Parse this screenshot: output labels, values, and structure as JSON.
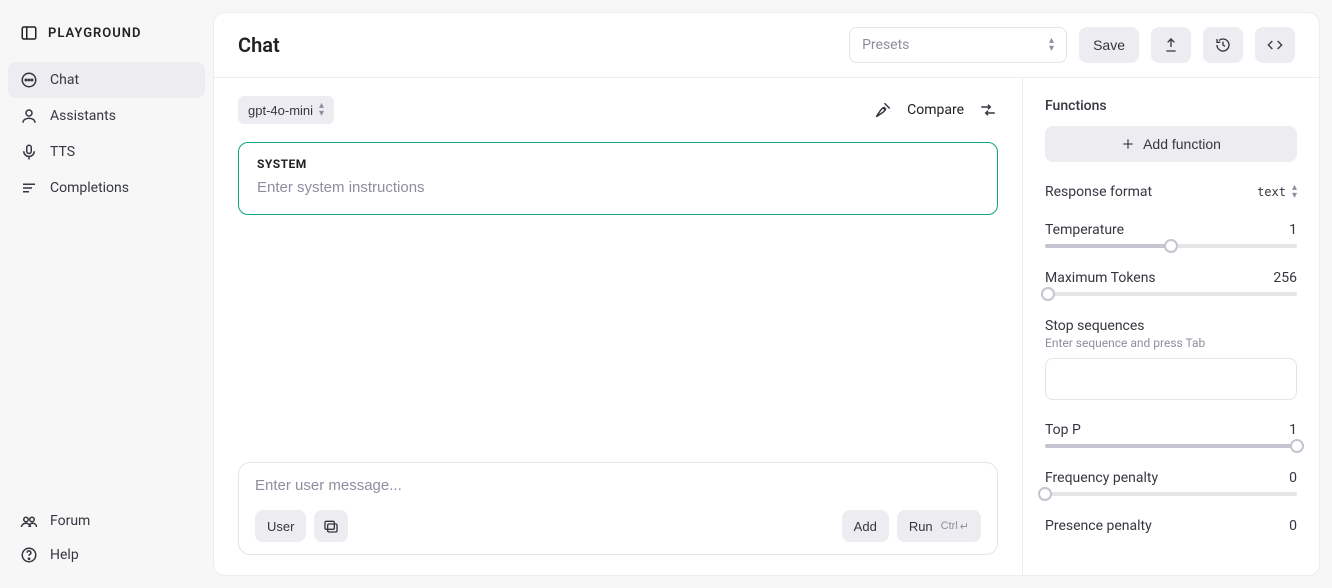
{
  "sidebar": {
    "title": "PLAYGROUND",
    "items": [
      {
        "label": "Chat",
        "icon": "chat-icon",
        "active": true
      },
      {
        "label": "Assistants",
        "icon": "assistant-icon",
        "active": false
      },
      {
        "label": "TTS",
        "icon": "mic-icon",
        "active": false
      },
      {
        "label": "Completions",
        "icon": "completions-icon",
        "active": false
      }
    ],
    "footer": [
      {
        "label": "Forum",
        "icon": "forum-icon"
      },
      {
        "label": "Help",
        "icon": "help-icon"
      }
    ]
  },
  "topbar": {
    "title": "Chat",
    "presets_placeholder": "Presets",
    "save_label": "Save"
  },
  "chat": {
    "model": "gpt-4o-mini",
    "compare_label": "Compare",
    "system_label": "SYSTEM",
    "system_placeholder": "Enter system instructions",
    "composer_placeholder": "Enter user message...",
    "role_button": "User",
    "add_button": "Add",
    "run_button": "Run",
    "run_shortcut": "Ctrl"
  },
  "settings": {
    "functions_label": "Functions",
    "add_function_label": "Add function",
    "response_format_label": "Response format",
    "response_format_value": "text",
    "temperature_label": "Temperature",
    "temperature_value": "1",
    "temperature_fill_pct": 50,
    "max_tokens_label": "Maximum Tokens",
    "max_tokens_value": "256",
    "max_tokens_fill_pct": 1,
    "stop_label": "Stop sequences",
    "stop_hint": "Enter sequence and press Tab",
    "top_p_label": "Top P",
    "top_p_value": "1",
    "top_p_fill_pct": 100,
    "freq_label": "Frequency penalty",
    "freq_value": "0",
    "freq_fill_pct": 0,
    "presence_label": "Presence penalty",
    "presence_value": "0"
  }
}
